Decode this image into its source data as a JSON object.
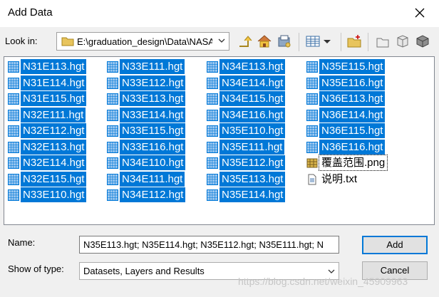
{
  "window": {
    "title": "Add Data"
  },
  "toolbar": {
    "look_in_label": "Look in:",
    "look_in_path": "E:\\graduation_design\\Data\\NASA"
  },
  "files": [
    {
      "name": "N31E113.hgt",
      "type": "grid",
      "selected": true
    },
    {
      "name": "N31E114.hgt",
      "type": "grid",
      "selected": true
    },
    {
      "name": "N31E115.hgt",
      "type": "grid",
      "selected": true
    },
    {
      "name": "N32E111.hgt",
      "type": "grid",
      "selected": true
    },
    {
      "name": "N32E112.hgt",
      "type": "grid",
      "selected": true
    },
    {
      "name": "N32E113.hgt",
      "type": "grid",
      "selected": true
    },
    {
      "name": "N32E114.hgt",
      "type": "grid",
      "selected": true
    },
    {
      "name": "N32E115.hgt",
      "type": "grid",
      "selected": true
    },
    {
      "name": "N33E110.hgt",
      "type": "grid",
      "selected": true
    },
    {
      "name": "N33E111.hgt",
      "type": "grid",
      "selected": true
    },
    {
      "name": "N33E112.hgt",
      "type": "grid",
      "selected": true
    },
    {
      "name": "N33E113.hgt",
      "type": "grid",
      "selected": true
    },
    {
      "name": "N33E114.hgt",
      "type": "grid",
      "selected": true
    },
    {
      "name": "N33E115.hgt",
      "type": "grid",
      "selected": true
    },
    {
      "name": "N33E116.hgt",
      "type": "grid",
      "selected": true
    },
    {
      "name": "N34E110.hgt",
      "type": "grid",
      "selected": true
    },
    {
      "name": "N34E111.hgt",
      "type": "grid",
      "selected": true
    },
    {
      "name": "N34E112.hgt",
      "type": "grid",
      "selected": true
    },
    {
      "name": "N34E113.hgt",
      "type": "grid",
      "selected": true
    },
    {
      "name": "N34E114.hgt",
      "type": "grid",
      "selected": true
    },
    {
      "name": "N34E115.hgt",
      "type": "grid",
      "selected": true
    },
    {
      "name": "N34E116.hgt",
      "type": "grid",
      "selected": true
    },
    {
      "name": "N35E110.hgt",
      "type": "grid",
      "selected": true
    },
    {
      "name": "N35E111.hgt",
      "type": "grid",
      "selected": true
    },
    {
      "name": "N35E112.hgt",
      "type": "grid",
      "selected": true
    },
    {
      "name": "N35E113.hgt",
      "type": "grid",
      "selected": true
    },
    {
      "name": "N35E114.hgt",
      "type": "grid",
      "selected": true
    },
    {
      "name": "N35E115.hgt",
      "type": "grid",
      "selected": true
    },
    {
      "name": "N35E116.hgt",
      "type": "grid",
      "selected": true
    },
    {
      "name": "N36E113.hgt",
      "type": "grid",
      "selected": true
    },
    {
      "name": "N36E114.hgt",
      "type": "grid",
      "selected": true
    },
    {
      "name": "N36E115.hgt",
      "type": "grid",
      "selected": true
    },
    {
      "name": "N36E116.hgt",
      "type": "grid",
      "selected": true
    },
    {
      "name": "覆盖范围.png",
      "type": "image",
      "selected": false,
      "focused": true
    },
    {
      "name": "说明.txt",
      "type": "text",
      "selected": false
    }
  ],
  "name_field": {
    "label": "Name:",
    "value": "N35E113.hgt; N35E114.hgt; N35E112.hgt; N35E111.hgt; N"
  },
  "type_field": {
    "label": "Show of type:",
    "value": "Datasets, Layers and Results"
  },
  "buttons": {
    "add": "Add",
    "cancel": "Cancel"
  },
  "colors": {
    "selection": "#0078d7",
    "default_button_border": "#0078d7"
  },
  "watermark": "https://blog.csdn.net/weixin_45909963"
}
